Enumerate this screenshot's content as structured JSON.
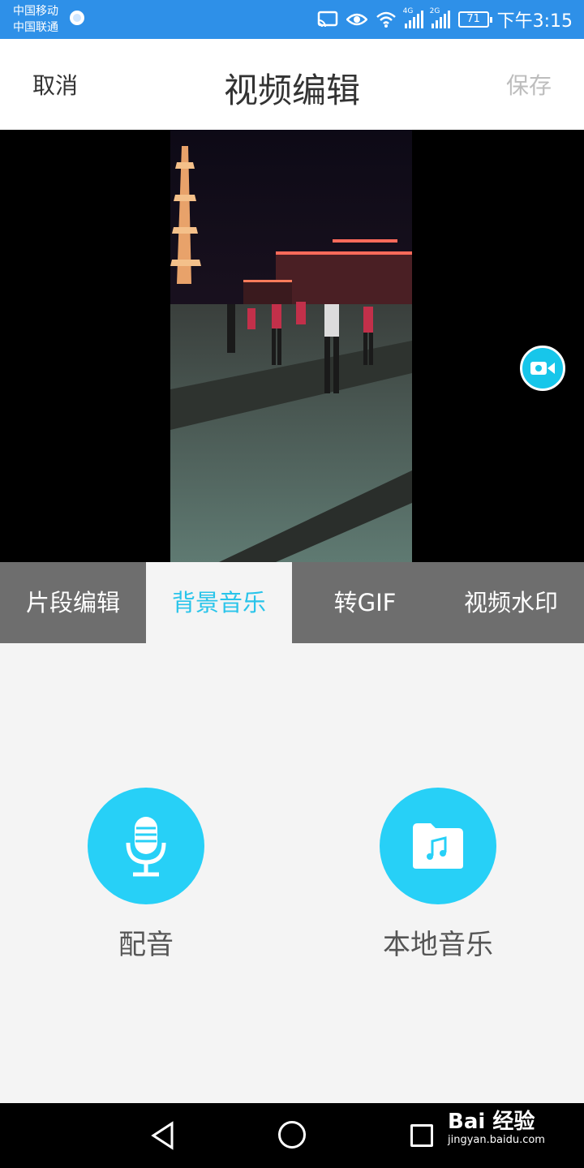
{
  "status_bar": {
    "carrier1": "中国移动",
    "carrier2": "中国联通",
    "signal1_tag": "4G",
    "signal2_tag": "2G",
    "battery": "71",
    "time": "下午3:15"
  },
  "header": {
    "cancel": "取消",
    "title": "视频编辑",
    "save": "保存"
  },
  "tabs": [
    {
      "label": "片段编辑"
    },
    {
      "label": "背景音乐"
    },
    {
      "label": "转GIF"
    },
    {
      "label": "视频水印"
    }
  ],
  "actions": {
    "dub_label": "配音",
    "local_music_label": "本地音乐"
  },
  "watermark": {
    "main": "Bai 经验",
    "sub": "jingyan.baidu.com"
  },
  "colors": {
    "status_bar": "#2e90e8",
    "accent": "#29c4ea",
    "tab_bar": "#6e6e6e"
  }
}
